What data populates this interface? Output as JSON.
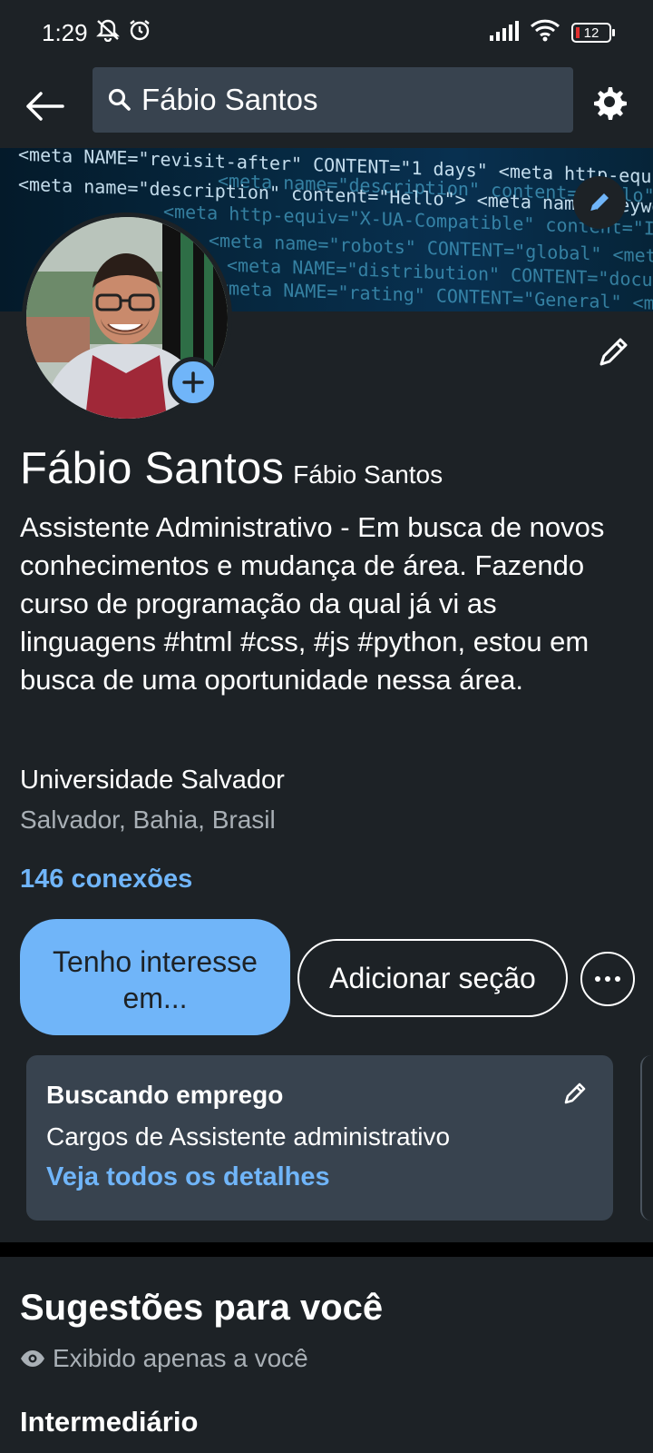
{
  "status": {
    "time": "1:29",
    "battery": "12"
  },
  "search": {
    "query": "Fábio Santos"
  },
  "banner": {
    "code_lines": [
      "<meta NAME=\"revisit-after\" CONTENT=\"1 days\" <meta http-equiv=\"x",
      "<meta name=\"description\" content=\"Hello\"> <meta name=\"keywo",
      "<meta http-equiv=\"X-UA-Compatible\" content=\"IE=Edge\"> <meta",
      "<meta name=\"robots\" CONTENT=\"global\" <meta http-eq",
      "<meta NAME=\"distribution\" CONTENT=\"document\" <meta con",
      "<meta NAME=\"rating\" CONTENT=\"General\" <meta name=\"author\""
    ]
  },
  "profile": {
    "name": "Fábio Santos",
    "pronoun": "Fábio Santos",
    "headline": "Assistente Administrativo - Em busca de novos conhecimentos e mudança de área. Fazendo curso de programação da qual já vi as linguagens #html #css, #js #python, estou em busca de uma oportunidade nessa área.",
    "school": "Universidade Salvador",
    "location": "Salvador, Bahia, Brasil",
    "connections": "146 conexões"
  },
  "actions": {
    "open_to": "Tenho interesse em...",
    "add_section": "Adicionar seção"
  },
  "job_card": {
    "title": "Buscando emprego",
    "roles": "Cargos de Assistente administrativo",
    "link": "Veja todos os detalhes"
  },
  "suggestions": {
    "title": "Sugestões para você",
    "private": "Exibido apenas a você",
    "level": "Intermediário"
  },
  "colors": {
    "accent": "#70b5f9",
    "background": "#1d2226",
    "card": "#38434f"
  }
}
